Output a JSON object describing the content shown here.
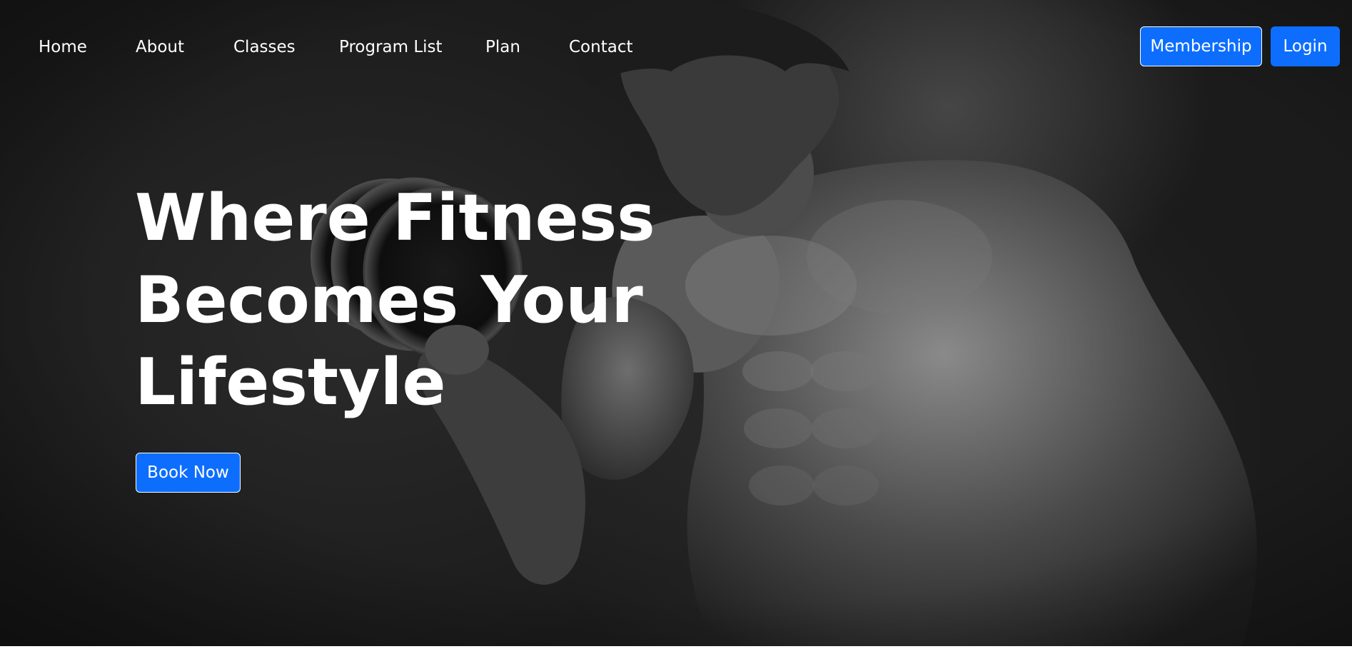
{
  "nav": {
    "links": [
      {
        "label": "Home"
      },
      {
        "label": "About"
      },
      {
        "label": "Classes"
      },
      {
        "label": "Program List"
      },
      {
        "label": "Plan"
      },
      {
        "label": "Contact"
      }
    ],
    "membership_label": "Membership",
    "login_label": "Login"
  },
  "hero": {
    "headline_lines": [
      "Where Fitness",
      "Becomes Your",
      "Lifestyle"
    ],
    "book_label": "Book Now",
    "image_subject": "bodybuilder-lifting-dumbbell"
  },
  "colors": {
    "accent": "#0d6efd",
    "text": "#ffffff",
    "background": "#1e1e1e"
  }
}
